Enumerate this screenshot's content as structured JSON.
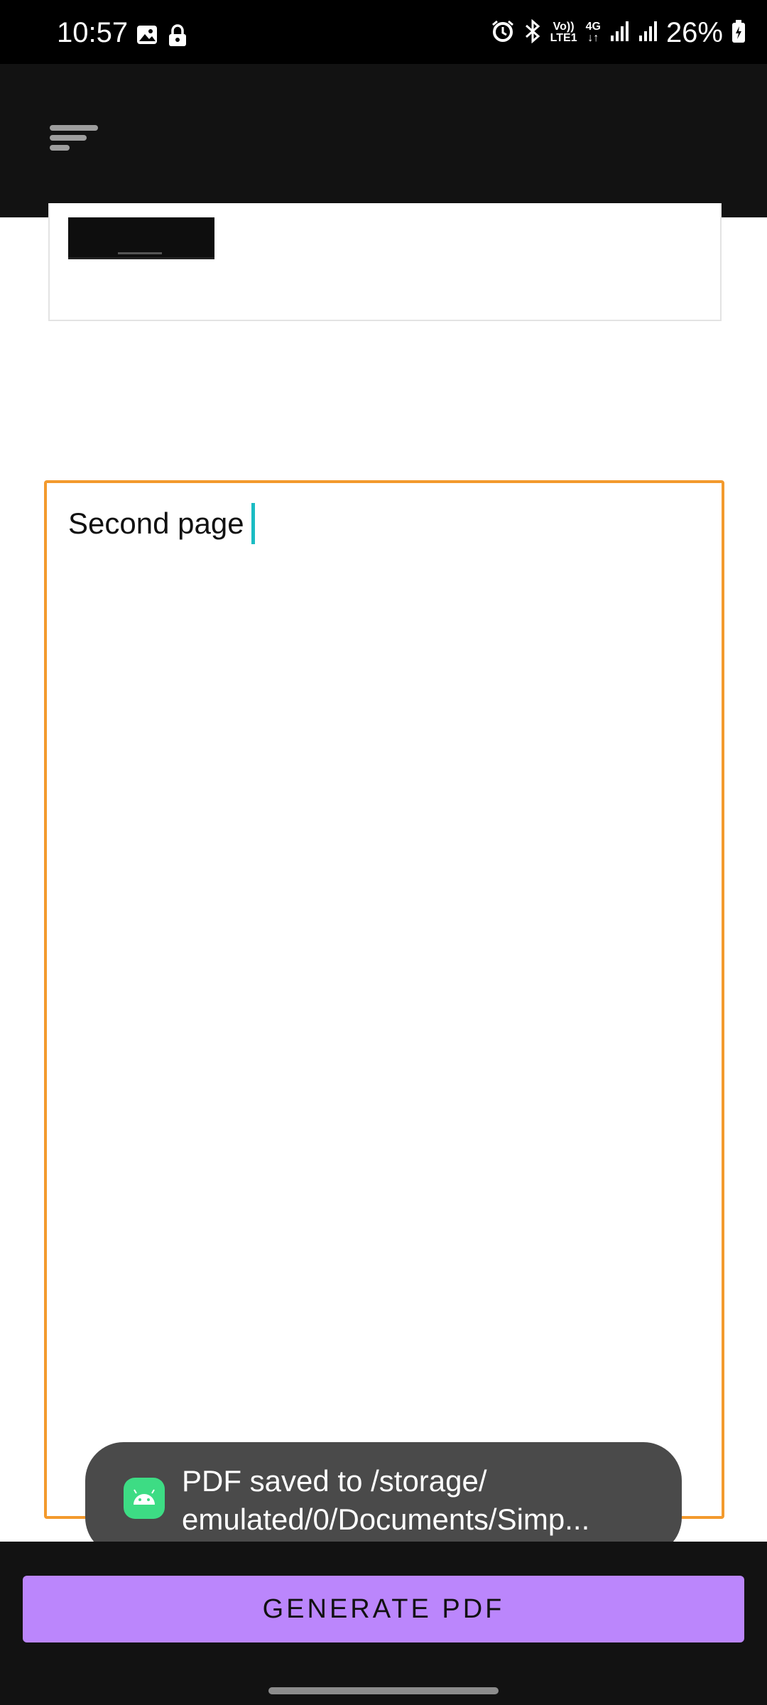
{
  "status_bar": {
    "time": "10:57",
    "left_icons": [
      "image-icon",
      "lock-icon"
    ],
    "right_icons": [
      "alarm-icon",
      "bluetooth-icon",
      "volte-icon",
      "4g-data-icon",
      "signal-icon",
      "signal-icon-2",
      "battery-charging-icon"
    ],
    "volte_label_top": "Vo))",
    "volte_label_bottom": "LTE1",
    "data_label": "4G",
    "battery": "26%"
  },
  "app_bar": {
    "menu_icon": "menu-icon"
  },
  "document": {
    "second_page_text": "Second page"
  },
  "toast": {
    "icon": "android-icon",
    "line1": "PDF saved to /storage/",
    "line2": "emulated/0/Documents/Simp..."
  },
  "bottom": {
    "generate_label": "GENERATE PDF"
  },
  "colors": {
    "accent": "#bb86fc",
    "page_border_active": "#f39a2d",
    "cursor": "#1bbcc3",
    "app_bar": "#121212"
  }
}
